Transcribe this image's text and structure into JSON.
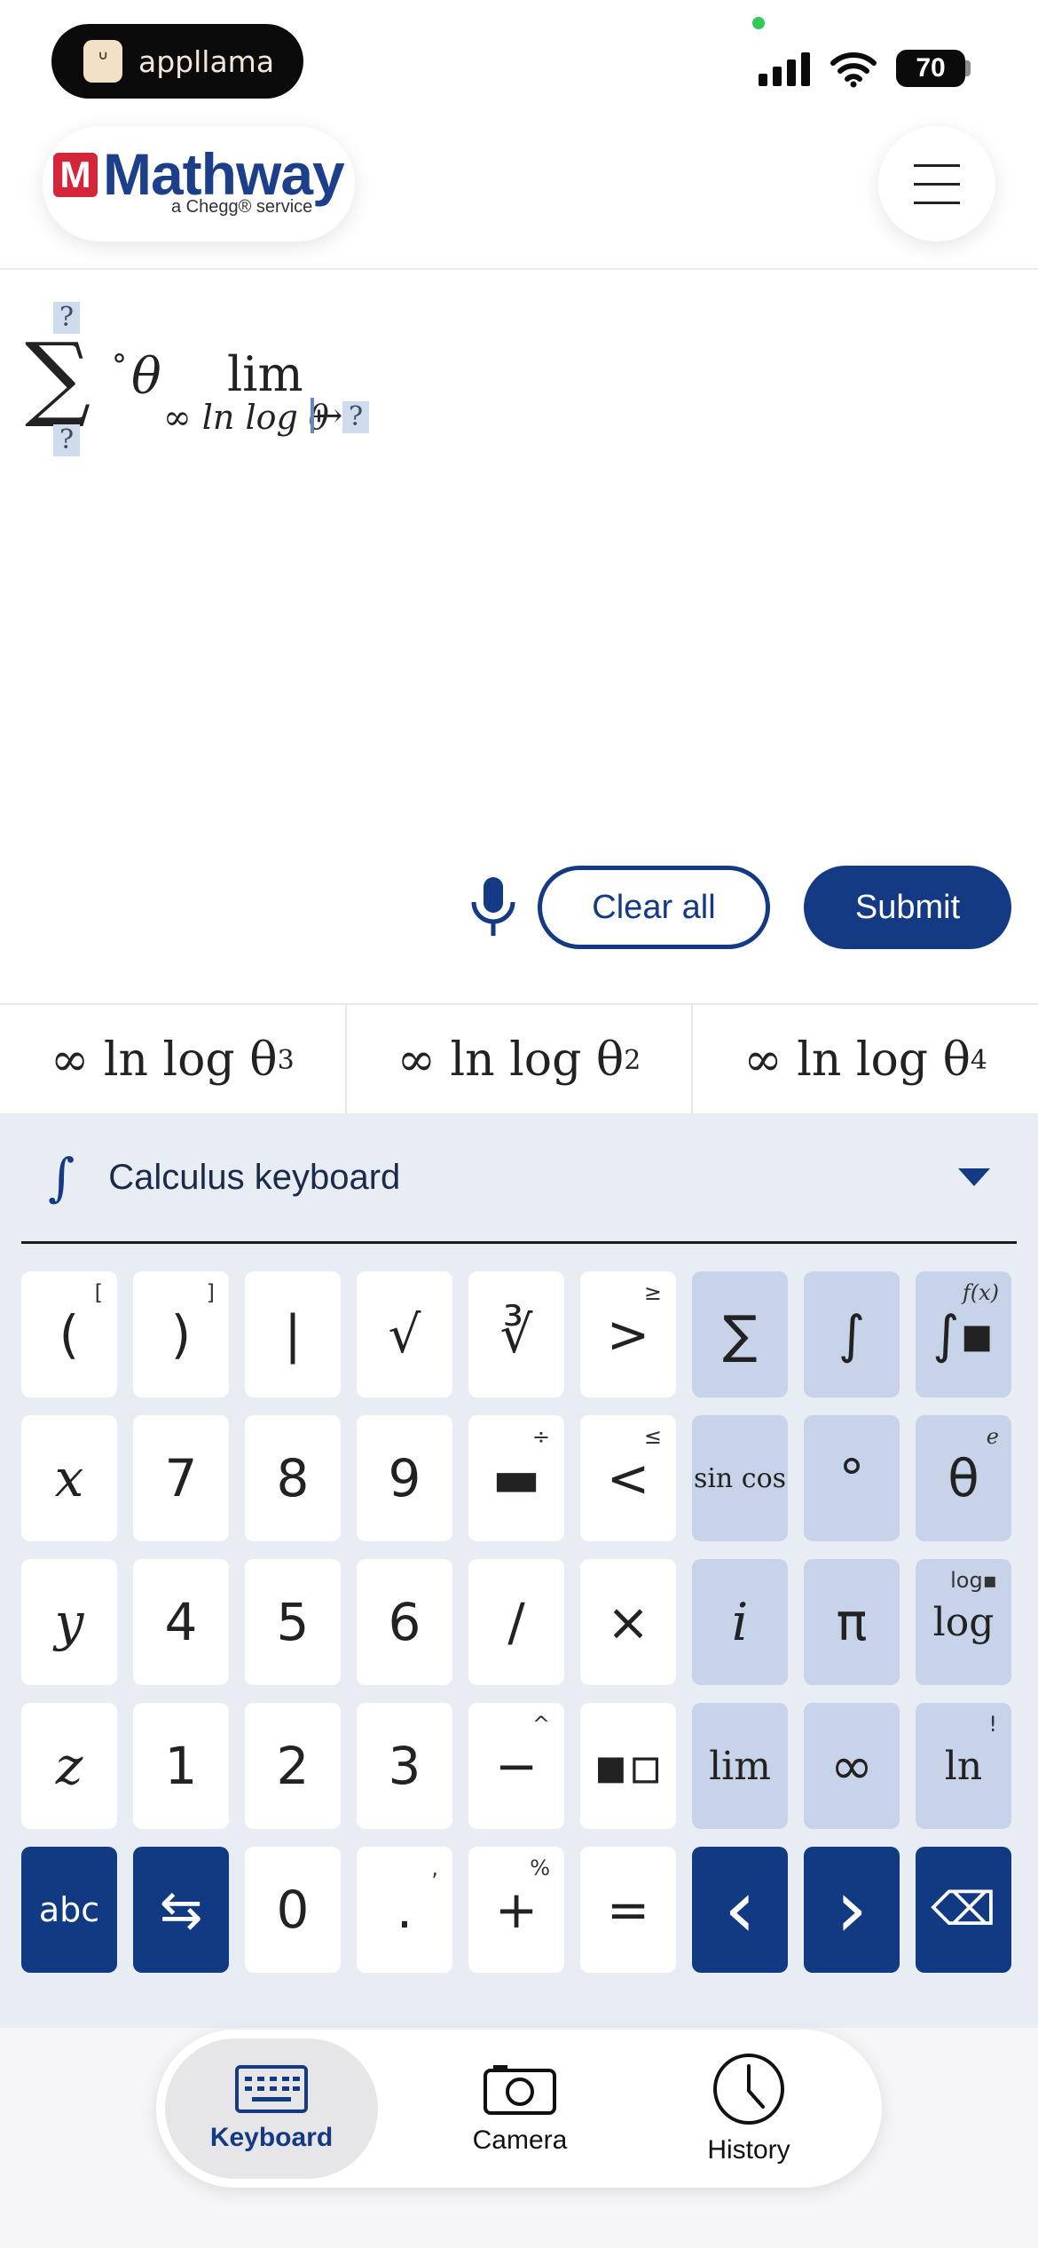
{
  "status_bar": {
    "app_badge": "appllama",
    "battery": "70"
  },
  "header": {
    "logo_letter": "M",
    "logo_text": "Mathway",
    "logo_subtitle": "a Chegg® service",
    "menu_icon": "hamburger-menu-icon"
  },
  "expression": {
    "placeholder": "?",
    "sigma": "∑",
    "degree": "°",
    "theta": "θ",
    "lim": "lim",
    "lim_sub": "∞ ln log θ",
    "arrow": "↦"
  },
  "actions": {
    "mic_icon": "microphone-icon",
    "clear": "Clear all",
    "submit": "Submit"
  },
  "suggestions": [
    {
      "base": "∞ ln log θ",
      "exp": "3"
    },
    {
      "base": "∞ ln log θ",
      "exp": "2"
    },
    {
      "base": "∞ ln log θ",
      "exp": "4"
    }
  ],
  "keyboard": {
    "icon": "∫",
    "title": "Calculus keyboard",
    "rows": [
      [
        {
          "label": "(",
          "sup": "["
        },
        {
          "label": ")",
          "sup": "]"
        },
        {
          "label": "|"
        },
        {
          "label": "√"
        },
        {
          "label": "∛"
        },
        {
          "label": ">",
          "sup": "≥"
        },
        {
          "label": "∑",
          "func": true
        },
        {
          "label": "∫",
          "func": true
        },
        {
          "label": "∫▪",
          "func": true,
          "sup": "f(x)"
        }
      ],
      [
        {
          "label": "x",
          "ital": true
        },
        {
          "label": "7"
        },
        {
          "label": "8"
        },
        {
          "label": "9"
        },
        {
          "label": "▬",
          "sup": "÷"
        },
        {
          "label": "<",
          "sup": "≤"
        },
        {
          "label": "sin cos",
          "func": true
        },
        {
          "label": "°",
          "func": true
        },
        {
          "label": "θ",
          "func": true,
          "sup": "e"
        }
      ],
      [
        {
          "label": "y",
          "ital": true
        },
        {
          "label": "4"
        },
        {
          "label": "5"
        },
        {
          "label": "6"
        },
        {
          "label": "/"
        },
        {
          "label": "×"
        },
        {
          "label": "i",
          "func": true,
          "ital": true
        },
        {
          "label": "π",
          "func": true
        },
        {
          "label": "log",
          "func": true,
          "sup": "log▪"
        }
      ],
      [
        {
          "label": "z",
          "ital": true
        },
        {
          "label": "1"
        },
        {
          "label": "2"
        },
        {
          "label": "3"
        },
        {
          "label": "−",
          "sup": "^"
        },
        {
          "label": "▪▫"
        },
        {
          "label": "lim",
          "func": true
        },
        {
          "label": "∞",
          "func": true
        },
        {
          "label": "ln",
          "func": true,
          "sup": "!"
        }
      ],
      [
        {
          "label": "abc",
          "dark": true
        },
        {
          "label": "⇆",
          "dark": true
        },
        {
          "label": "0"
        },
        {
          "label": ".",
          "sup": ","
        },
        {
          "label": "+",
          "sup": "%"
        },
        {
          "label": "="
        },
        {
          "label": "‹",
          "dark": true
        },
        {
          "label": "›",
          "dark": true
        },
        {
          "label": "⌫",
          "dark": true
        }
      ]
    ]
  },
  "nav": {
    "keyboard": "Keyboard",
    "camera": "Camera",
    "history": "History"
  }
}
